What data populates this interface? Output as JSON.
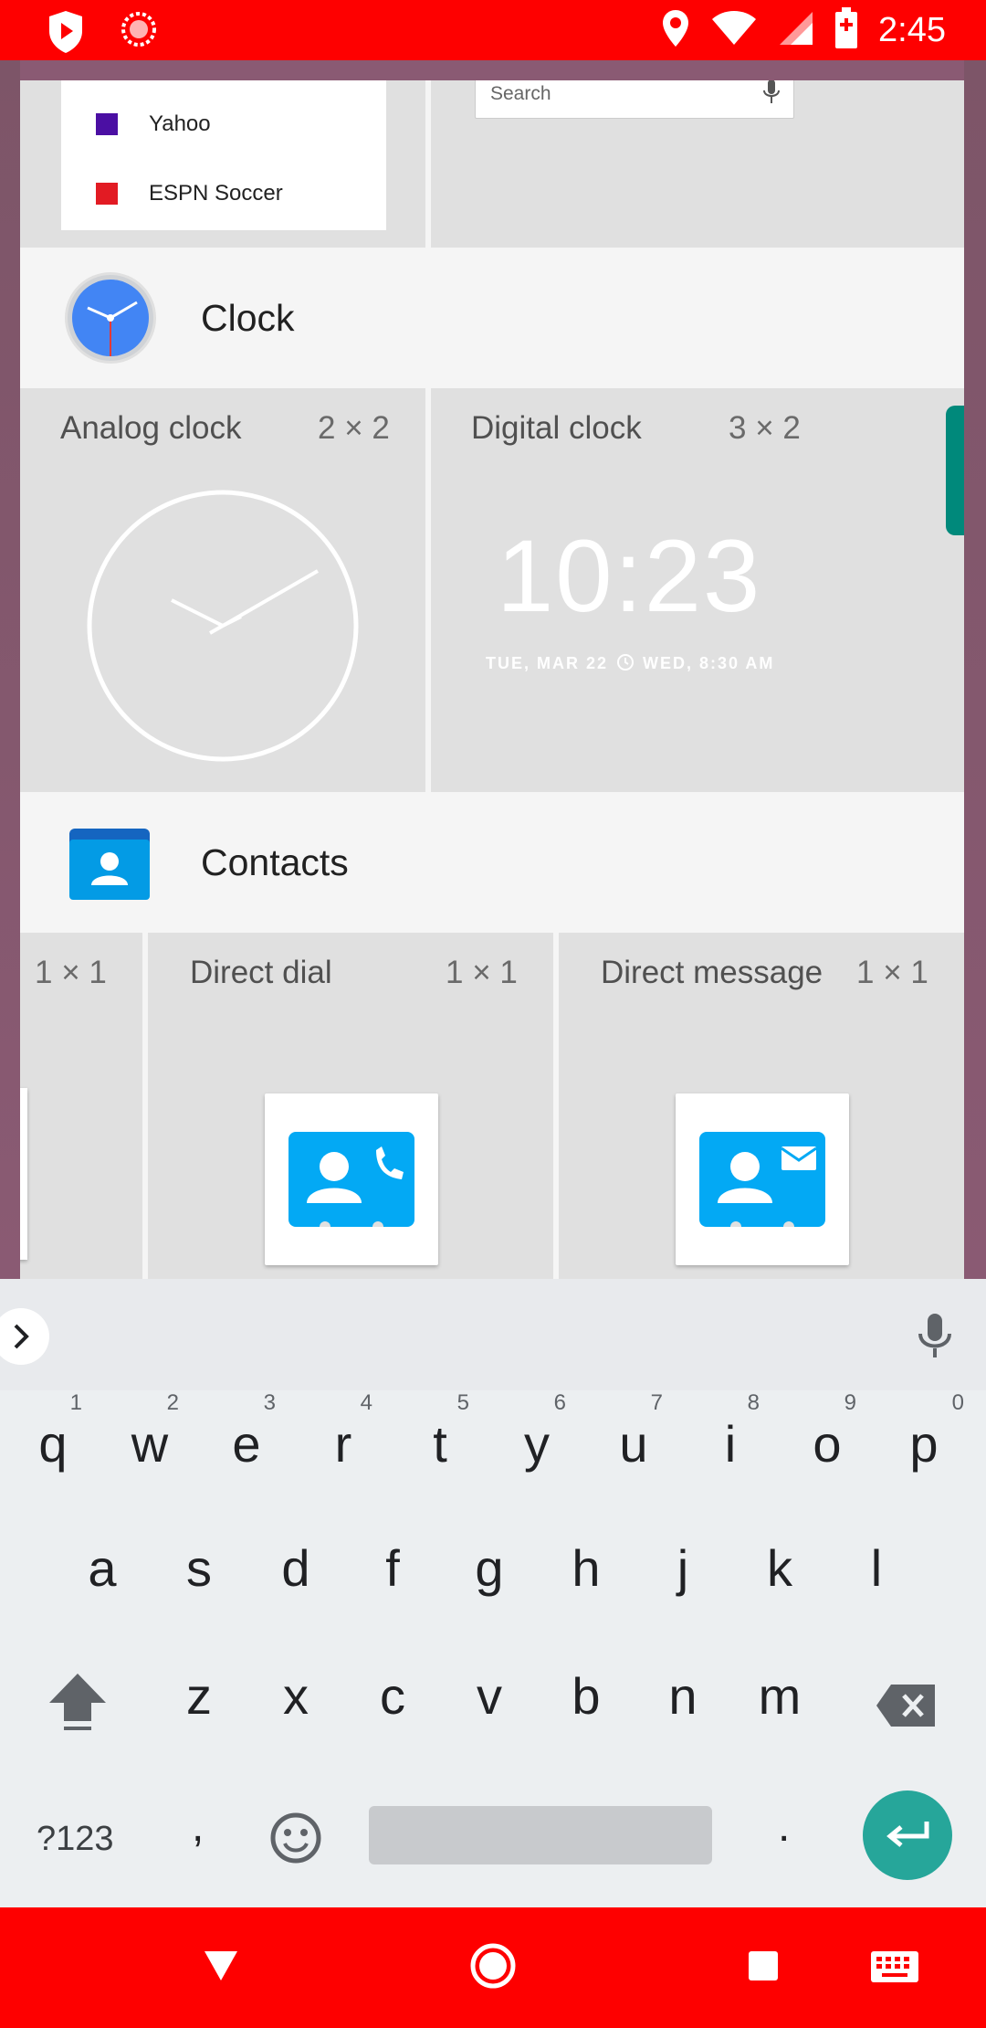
{
  "status_bar": {
    "time": "2:45",
    "left_icons": [
      "shield-play-icon",
      "sync-circle-icon"
    ],
    "right_icons": [
      "location-icon",
      "wifi-icon",
      "signal-icon",
      "battery-icon"
    ],
    "bg_color": "#fe0000"
  },
  "top_widgets": {
    "list_items": [
      {
        "label": "Yahoo",
        "color": "#4b0fa3"
      },
      {
        "label": "ESPN Soccer",
        "color": "#e21b23"
      }
    ],
    "search_placeholder": "Search"
  },
  "sections": {
    "clock": {
      "title": "Clock",
      "widgets": [
        {
          "title": "Analog clock",
          "size": "2 × 2"
        },
        {
          "title": "Digital clock",
          "size": "3 × 2",
          "time": "10:23",
          "date_line": "TUE, MAR 22",
          "alarm_line": "WED, 8:30 AM"
        }
      ]
    },
    "contacts": {
      "title": "Contacts",
      "widgets": [
        {
          "title": "",
          "size": "1 × 1"
        },
        {
          "title": "Direct dial",
          "size": "1 × 1"
        },
        {
          "title": "Direct message",
          "size": "1 × 1"
        }
      ]
    }
  },
  "keyboard": {
    "row1": [
      {
        "k": "q",
        "n": "1"
      },
      {
        "k": "w",
        "n": "2"
      },
      {
        "k": "e",
        "n": "3"
      },
      {
        "k": "r",
        "n": "4"
      },
      {
        "k": "t",
        "n": "5"
      },
      {
        "k": "y",
        "n": "6"
      },
      {
        "k": "u",
        "n": "7"
      },
      {
        "k": "i",
        "n": "8"
      },
      {
        "k": "o",
        "n": "9"
      },
      {
        "k": "p",
        "n": "0"
      }
    ],
    "row2": [
      "a",
      "s",
      "d",
      "f",
      "g",
      "h",
      "j",
      "k",
      "l"
    ],
    "row3": [
      "z",
      "x",
      "c",
      "v",
      "b",
      "n",
      "m"
    ],
    "symbols_label": "?123",
    "comma": ",",
    "period": ".",
    "accent_color": "#26a69a"
  },
  "nav_bar": {
    "buttons": [
      "back-icon",
      "home-icon",
      "recents-icon",
      "keyboard-switch-icon"
    ]
  }
}
